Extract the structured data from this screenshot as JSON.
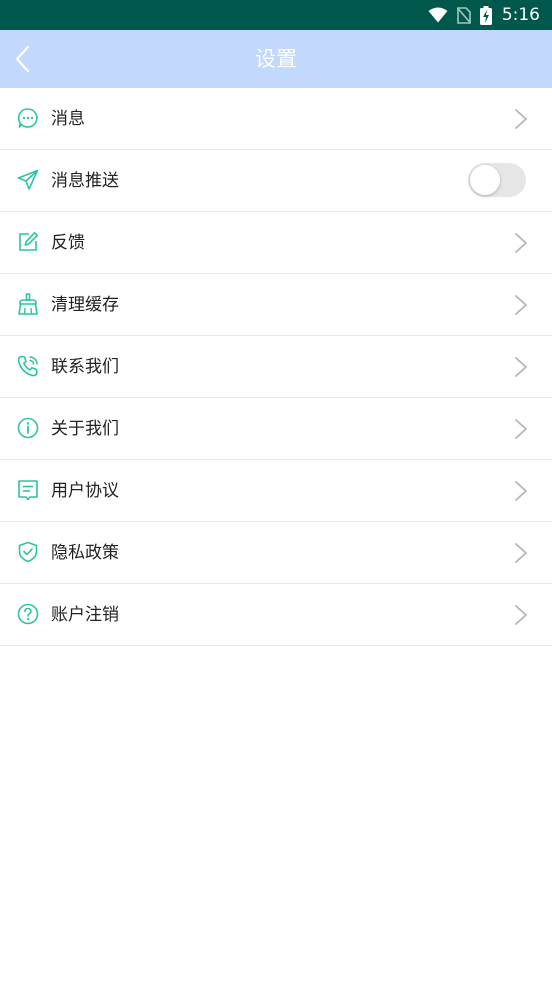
{
  "status_bar": {
    "time": "5:16",
    "icons": [
      "wifi-icon",
      "no-sim-icon",
      "battery-charging-icon"
    ],
    "background": "#00574b"
  },
  "header": {
    "title": "设置",
    "background": "#c2d8fc",
    "back_icon": "chevron-left-icon"
  },
  "settings": {
    "accent_color": "#2ec4a0",
    "items": [
      {
        "label": "消息",
        "icon": "chat-bubble-icon",
        "control": "chevron"
      },
      {
        "label": "消息推送",
        "icon": "paper-plane-icon",
        "control": "toggle",
        "enabled": false
      },
      {
        "label": "反馈",
        "icon": "edit-icon",
        "control": "chevron"
      },
      {
        "label": "清理缓存",
        "icon": "broom-icon",
        "control": "chevron"
      },
      {
        "label": "联系我们",
        "icon": "phone-icon",
        "control": "chevron"
      },
      {
        "label": "关于我们",
        "icon": "info-icon",
        "control": "chevron"
      },
      {
        "label": "用户协议",
        "icon": "document-icon",
        "control": "chevron"
      },
      {
        "label": "隐私政策",
        "icon": "shield-check-icon",
        "control": "chevron"
      },
      {
        "label": "账户注销",
        "icon": "question-icon",
        "control": "chevron"
      }
    ]
  }
}
